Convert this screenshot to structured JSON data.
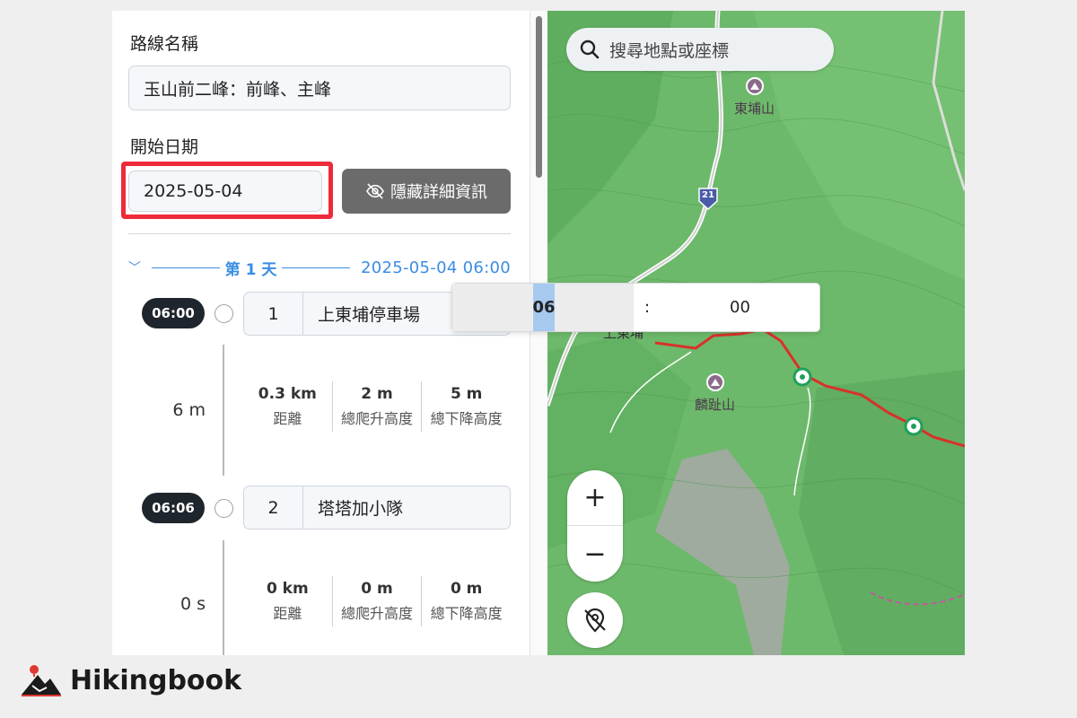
{
  "form": {
    "route_name_label": "路線名稱",
    "route_name_value": "玉山前二峰：前峰、主峰",
    "start_date_label": "開始日期",
    "start_date_value": "2025-05-04",
    "hide_details_label": "隱藏詳細資訊"
  },
  "day": {
    "label": "第 1 天",
    "datetime": "2025-05-04 06:00"
  },
  "waypoints": [
    {
      "time": "06:00",
      "num": "1",
      "name": "上東埔停車場"
    },
    {
      "time": "06:06",
      "num": "2",
      "name": "塔塔加小隊"
    }
  ],
  "segments": [
    {
      "duration": "6 m",
      "distance": "0.3 km",
      "ascent": "2 m",
      "descent": "5 m"
    },
    {
      "duration": "0 s",
      "distance": "0 km",
      "ascent": "0 m",
      "descent": "0 m"
    }
  ],
  "stat_labels": {
    "distance": "距離",
    "ascent": "總爬升高度",
    "descent": "總下降高度"
  },
  "time_picker": {
    "hour": "06",
    "separator": ":",
    "minute": "00"
  },
  "map": {
    "search_placeholder": "搜尋地點或座標",
    "peak_1": "東埔山",
    "peak_2": "麟趾山",
    "place_fragment": "上東埔",
    "road_number": "21",
    "zoom_in": "+",
    "zoom_out": "−"
  },
  "brand": {
    "name": "Hikingbook"
  },
  "colors": {
    "accent_blue": "#3a8de4",
    "highlight_red": "#ee2b3b",
    "route_red": "#d9312b",
    "waypoint_green": "#1fa05a"
  }
}
